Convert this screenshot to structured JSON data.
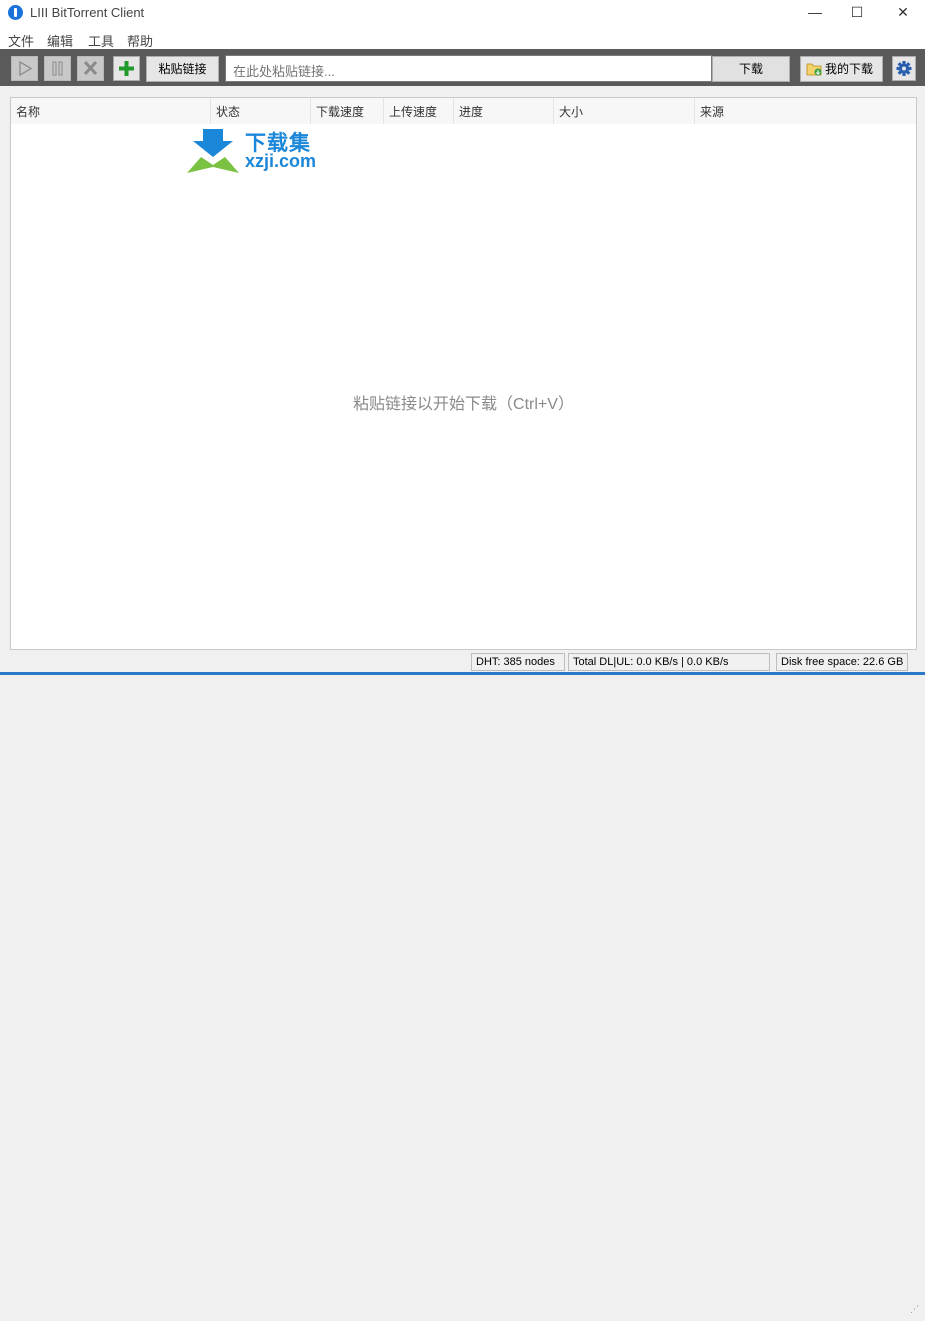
{
  "window": {
    "title": "LIII BitTorrent Client",
    "minimize_glyph": "—",
    "maximize_glyph": "☐",
    "close_glyph": "✕"
  },
  "menu": [
    "文件",
    "编辑",
    "工具",
    "帮助"
  ],
  "toolbar": {
    "play_icon": "play-icon",
    "pause_icon": "pause-icon",
    "remove_icon": "remove-icon",
    "add_icon": "plus-icon",
    "paste_link_label": "粘贴链接",
    "link_placeholder": "在此处粘贴链接...",
    "download_label": "下载",
    "my_downloads_label": "我的下载",
    "settings_icon": "gear-icon"
  },
  "columns": [
    "名称",
    "状态",
    "下载速度",
    "上传速度",
    "进度",
    "大小",
    "来源"
  ],
  "list": {
    "empty_message": "粘贴链接以开始下载（Ctrl+V）"
  },
  "watermark": {
    "line1": "下载集",
    "line2": "xzji.com"
  },
  "status": {
    "dht": "DHT: 385 nodes",
    "total": "Total DL|UL: 0.0 KB/s | 0.0 KB/s",
    "disk": "Disk free space: 22.6 GB"
  },
  "colors": {
    "toolbar_bg": "#5a5a5a",
    "accent_blue": "#2a78c6",
    "add_green": "#1f9a2b",
    "watermark_blue": "#1b87d8",
    "watermark_green": "#7cc242"
  }
}
